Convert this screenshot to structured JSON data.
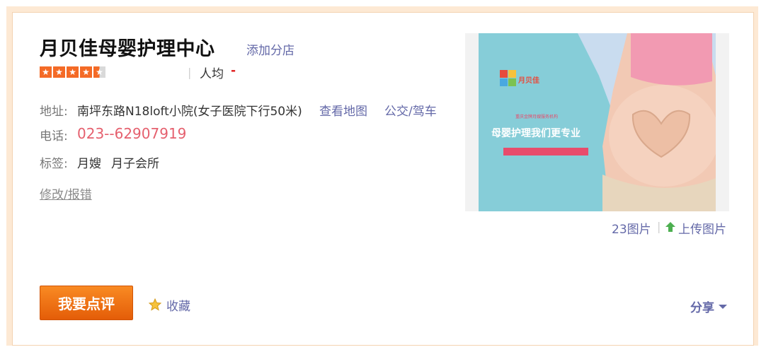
{
  "shop": {
    "name": "月贝佳母婴护理中心",
    "add_branch": "添加分店",
    "rating_stars": 4.5,
    "avg_label": "人均",
    "avg_value": "-"
  },
  "address": {
    "label": "地址:",
    "value": "南坪东路N18loft小院(女子医院下行50米)",
    "map_link": "查看地图",
    "transit_link": "公交/驾车"
  },
  "phone": {
    "label": "电话:",
    "value": "023--62907919"
  },
  "tags": {
    "label": "标签:",
    "items": [
      "月嫂",
      "月子会所"
    ]
  },
  "edit_link": "修改/报错",
  "photo": {
    "logo_text": "月贝佳",
    "banner_subtitle": "重庆金牌月嫂服务机构",
    "banner_headline": "母婴护理我们更专业",
    "count": "23图片",
    "upload": "上传图片"
  },
  "actions": {
    "review_button": "我要点评",
    "favorite": "收藏",
    "share": "分享"
  },
  "colors": {
    "accent_orange": "#f46a26",
    "link": "#6469a8",
    "phone": "#e5606e",
    "frame": "#fde9d4"
  }
}
